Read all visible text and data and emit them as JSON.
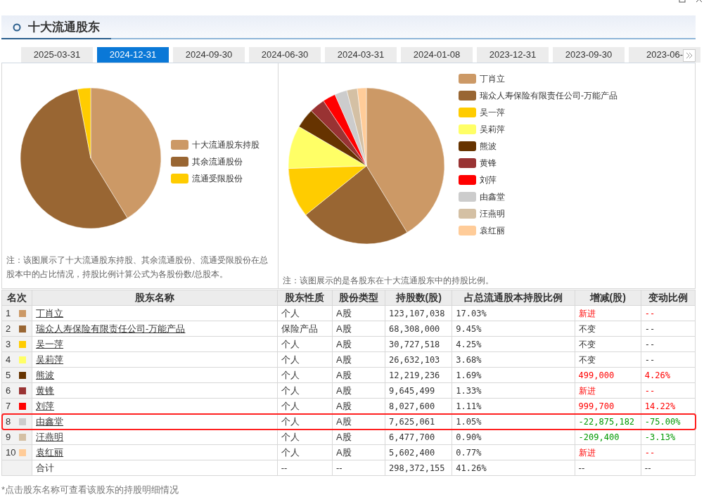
{
  "section": {
    "title": "十大流通股东"
  },
  "tabs": [
    {
      "label": "2025-03-31",
      "selected": false
    },
    {
      "label": "2024-12-31",
      "selected": true
    },
    {
      "label": "2024-09-30",
      "selected": false
    },
    {
      "label": "2024-06-30",
      "selected": false
    },
    {
      "label": "2024-03-31",
      "selected": false
    },
    {
      "label": "2024-01-08",
      "selected": false
    },
    {
      "label": "2023-12-31",
      "selected": false
    },
    {
      "label": "2023-09-30",
      "selected": false
    },
    {
      "label": "2023-06-",
      "selected": false
    }
  ],
  "left_chart": {
    "legend": [
      {
        "label": "十大流通股东持股",
        "color": "#cc9966"
      },
      {
        "label": "其余流通股份",
        "color": "#996633"
      },
      {
        "label": "流通受限股份",
        "color": "#ffcc00"
      }
    ],
    "note": "注：该图展示了十大流通股东持股、其余流通股份、流通受限股份在总股本中的占比情况，持股比例计算公式为各股份数/总股本。"
  },
  "right_chart": {
    "legend": [
      {
        "label": "丁肖立",
        "color": "#cc9966"
      },
      {
        "label": "瑞众人寿保险有限责任公司-万能产品",
        "color": "#996633"
      },
      {
        "label": "吴一萍",
        "color": "#ffcc00"
      },
      {
        "label": "吴莉萍",
        "color": "#ffff66"
      },
      {
        "label": "熊波",
        "color": "#663300"
      },
      {
        "label": "黄锋",
        "color": "#993333"
      },
      {
        "label": "刘萍",
        "color": "#ff0000"
      },
      {
        "label": "由鑫堂",
        "color": "#cccccc"
      },
      {
        "label": "汪燕明",
        "color": "#d4c0a4"
      },
      {
        "label": "袁红丽",
        "color": "#ffcc99"
      }
    ],
    "note": "注：该图展示的是各股东在十大流通股东中的持股比例。"
  },
  "table": {
    "columns": [
      "名次",
      "股东名称",
      "股东性质",
      "股份类型",
      "持股数(股)",
      "占总流通股本持股比例",
      "增减(股)",
      "变动比例"
    ],
    "rows": [
      {
        "rank": "1",
        "color": "#cc9966",
        "name": "丁肖立",
        "nature": "个人",
        "type": "A股",
        "shares": "123,107,038",
        "ratio": "17.03%",
        "change": "新进",
        "change_ratio": "--",
        "kind": "increase",
        "highlighted": false
      },
      {
        "rank": "2",
        "color": "#996633",
        "name": "瑞众人寿保险有限责任公司-万能产品",
        "nature": "保险产品",
        "type": "A股",
        "shares": "68,308,000",
        "ratio": "9.45%",
        "change": "不变",
        "change_ratio": "--",
        "kind": "unchanged",
        "highlighted": false
      },
      {
        "rank": "3",
        "color": "#ffcc00",
        "name": "吴一萍",
        "nature": "个人",
        "type": "A股",
        "shares": "30,727,518",
        "ratio": "4.25%",
        "change": "不变",
        "change_ratio": "--",
        "kind": "unchanged",
        "highlighted": false
      },
      {
        "rank": "4",
        "color": "#ffff66",
        "name": "吴莉萍",
        "nature": "个人",
        "type": "A股",
        "shares": "26,632,103",
        "ratio": "3.68%",
        "change": "不变",
        "change_ratio": "--",
        "kind": "unchanged",
        "highlighted": false
      },
      {
        "rank": "5",
        "color": "#663300",
        "name": "熊波",
        "nature": "个人",
        "type": "A股",
        "shares": "12,219,236",
        "ratio": "1.69%",
        "change": "499,000",
        "change_ratio": "4.26%",
        "kind": "increase",
        "highlighted": false
      },
      {
        "rank": "6",
        "color": "#993333",
        "name": "黄锋",
        "nature": "个人",
        "type": "A股",
        "shares": "9,645,499",
        "ratio": "1.33%",
        "change": "新进",
        "change_ratio": "--",
        "kind": "increase",
        "highlighted": false
      },
      {
        "rank": "7",
        "color": "#ff0000",
        "name": "刘萍",
        "nature": "个人",
        "type": "A股",
        "shares": "8,027,600",
        "ratio": "1.11%",
        "change": "999,700",
        "change_ratio": "14.22%",
        "kind": "increase",
        "highlighted": false
      },
      {
        "rank": "8",
        "color": "#cccccc",
        "name": "由鑫堂",
        "nature": "个人",
        "type": "A股",
        "shares": "7,625,061",
        "ratio": "1.05%",
        "change": "-22,875,182",
        "change_ratio": "-75.00%",
        "kind": "decrease",
        "highlighted": true
      },
      {
        "rank": "9",
        "color": "#d4c0a4",
        "name": "汪燕明",
        "nature": "个人",
        "type": "A股",
        "shares": "6,477,700",
        "ratio": "0.90%",
        "change": "-209,400",
        "change_ratio": "-3.13%",
        "kind": "decrease",
        "highlighted": false
      },
      {
        "rank": "10",
        "color": "#ffcc99",
        "name": "袁红丽",
        "nature": "个人",
        "type": "A股",
        "shares": "5,602,400",
        "ratio": "0.77%",
        "change": "新进",
        "change_ratio": "--",
        "kind": "increase",
        "highlighted": false
      }
    ],
    "total": {
      "label": "合计",
      "nature": "--",
      "type": "--",
      "shares": "298,372,155",
      "ratio": "41.26%",
      "change": "--",
      "change_ratio": "--"
    }
  },
  "footnote": "*点击股东名称可查看该股东的持股明细情况"
}
